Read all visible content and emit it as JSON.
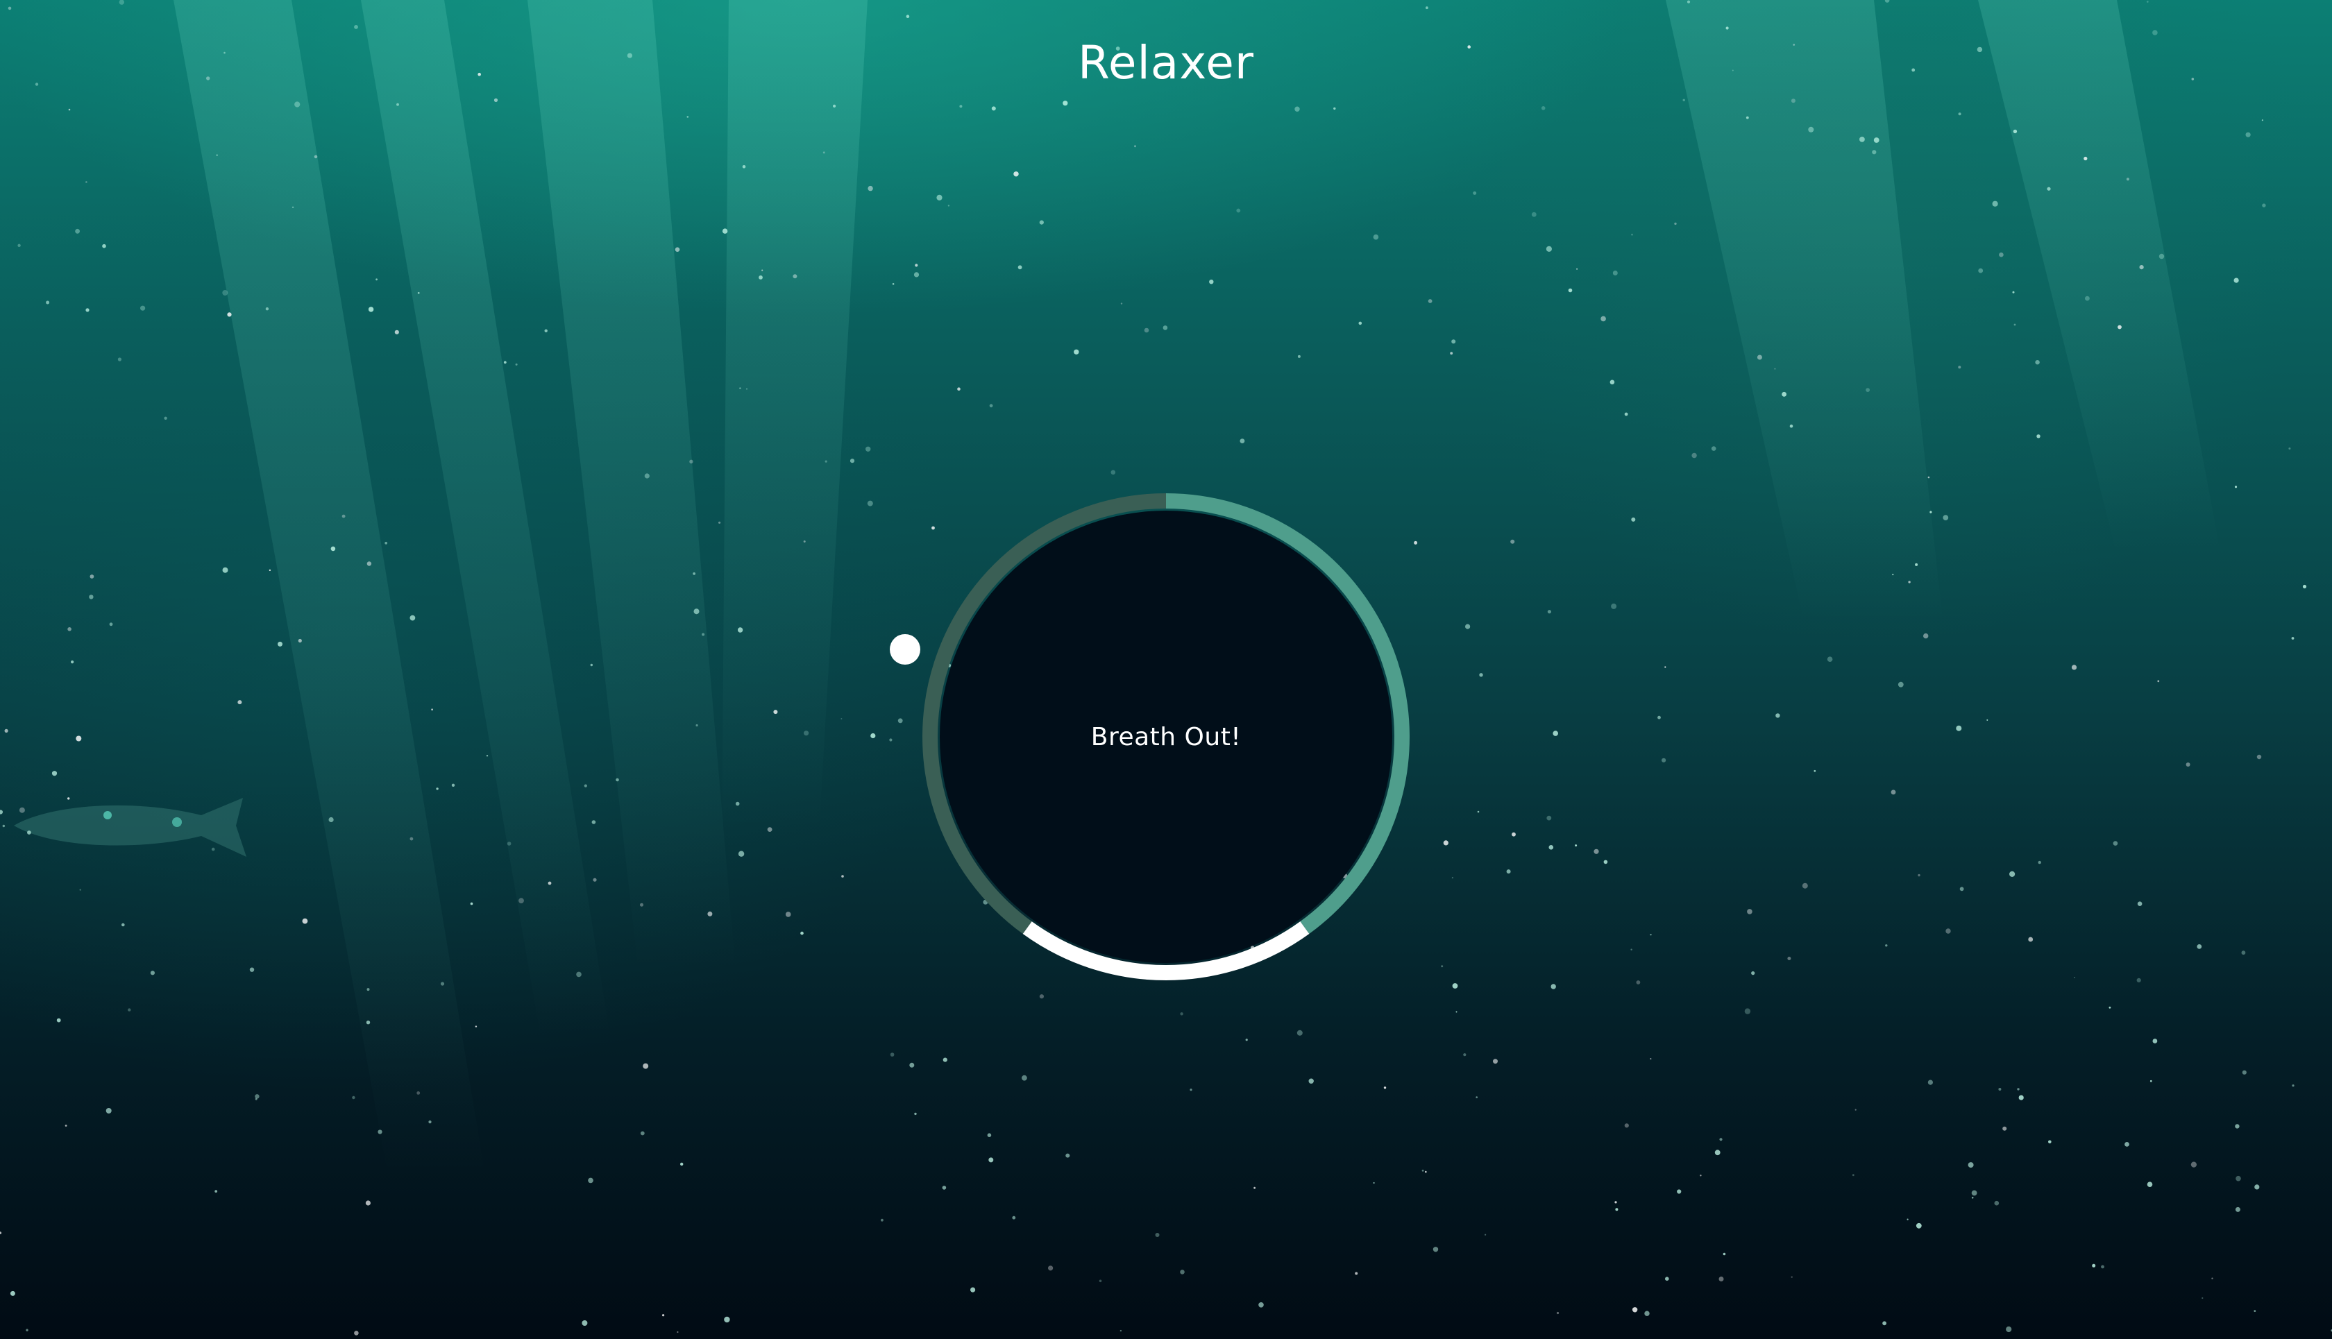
{
  "app": {
    "title": "Relaxer"
  },
  "breathing": {
    "status_text": "Breath Out!",
    "phases": [
      {
        "name": "breathe-in",
        "portion": 0.4,
        "color": "#4f9e8c"
      },
      {
        "name": "hold",
        "portion": 0.2,
        "color": "#ffffff"
      },
      {
        "name": "breathe-out",
        "portion": 0.4,
        "color": "#3a5f55"
      }
    ],
    "pointer_angle_deg": 290
  },
  "colors": {
    "background_top": "#0c7f74",
    "background_bottom": "#010b14",
    "inner_circle": "#010e19",
    "accent_light": "#4f9e8c",
    "accent_dark": "#3a5f55",
    "pointer": "#ffffff"
  },
  "icons": {
    "pointer": "circle-dot-icon"
  }
}
